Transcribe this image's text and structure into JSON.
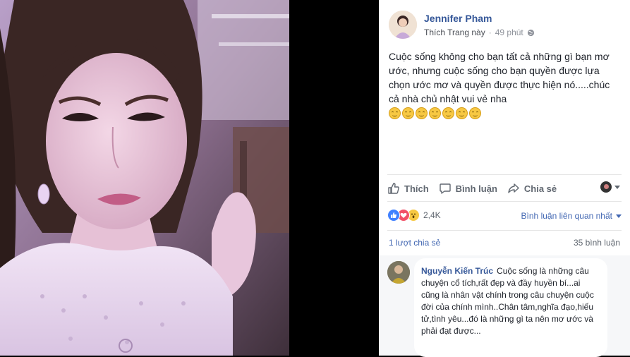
{
  "post": {
    "author": "Jennifer Pham",
    "page_like_label": "Thích Trang này",
    "separator": "·",
    "time": "49 phút",
    "text": "Cuộc sống không cho bạn tất cả những gì bạn mơ ước, nhưng cuộc sống cho bạn quyền được lựa chọn ước mơ và quyền được thực hiện nó.....chúc cả nhà chủ nhật vui vẻ nha",
    "emoji_count": 7,
    "emoji_icon": "smiling-face-icon"
  },
  "actions": {
    "like": "Thích",
    "comment": "Bình luận",
    "share": "Chia sẻ"
  },
  "reactions": {
    "types": [
      "like-icon",
      "love-icon",
      "wow-icon"
    ],
    "count": "2,4K",
    "sort_label": "Bình luận liên quan nhất"
  },
  "stats": {
    "shares": "1 lượt chia sẻ",
    "comments": "35 bình luận"
  },
  "comment": {
    "author": "Nguyễn Kiến Trúc",
    "text": "Cuộc sống là những câu chuyện cổ tích,rất đẹp và đầy huyền bí...ai cũng là nhân vật chính trong câu chuyện cuộc đời của chính mình..Chân tâm,nghĩa đạo,hiếu tử,tình yêu...đó là những gì ta nên mơ ước và phải đạt được..."
  },
  "colors": {
    "link": "#365899",
    "accent": "#4267b2",
    "secondary_text": "#90949c",
    "like": "#4080ff",
    "love": "#f25268",
    "wow": "#f7c843"
  }
}
